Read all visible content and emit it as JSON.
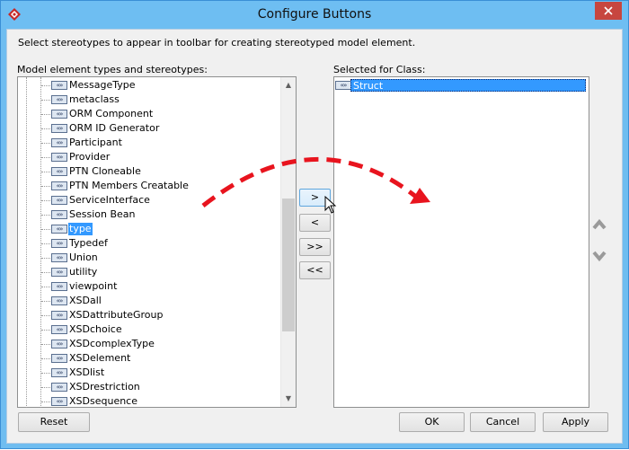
{
  "window": {
    "title": "Configure Buttons",
    "titlebar_color": "#6ebef2",
    "close_color": "#c7463f"
  },
  "description": "Select stereotypes to appear in toolbar for creating stereotyped model element.",
  "left_list": {
    "label": "Model element types and stereotypes:",
    "items": [
      {
        "label": "MessageType"
      },
      {
        "label": "metaclass"
      },
      {
        "label": "ORM Component"
      },
      {
        "label": "ORM ID Generator"
      },
      {
        "label": "Participant"
      },
      {
        "label": "Provider"
      },
      {
        "label": "PTN Cloneable"
      },
      {
        "label": "PTN Members Creatable"
      },
      {
        "label": "ServiceInterface"
      },
      {
        "label": "Session Bean"
      },
      {
        "label": "type",
        "selected": true
      },
      {
        "label": "Typedef"
      },
      {
        "label": "Union"
      },
      {
        "label": "utility"
      },
      {
        "label": "viewpoint"
      },
      {
        "label": "XSDall"
      },
      {
        "label": "XSDattributeGroup"
      },
      {
        "label": "XSDchoice"
      },
      {
        "label": "XSDcomplexType"
      },
      {
        "label": "XSDelement"
      },
      {
        "label": "XSDlist"
      },
      {
        "label": "XSDrestriction"
      },
      {
        "label": "XSDsequence"
      }
    ],
    "icon": "stereotype-icon",
    "icon_glyph": "«»"
  },
  "right_list": {
    "label": "Selected for Class:",
    "items": [
      {
        "label": "Struct",
        "selected": true
      }
    ]
  },
  "transfer_buttons": {
    "add": ">",
    "remove": "<",
    "add_all": ">>",
    "remove_all": "<<"
  },
  "footer": {
    "reset": "Reset",
    "ok": "OK",
    "cancel": "Cancel",
    "apply": "Apply"
  },
  "annotation": {
    "arrow_color": "#e8141e",
    "arrow_icon": "dashed-curved-arrow"
  },
  "colors": {
    "selection": "#3399ff"
  }
}
